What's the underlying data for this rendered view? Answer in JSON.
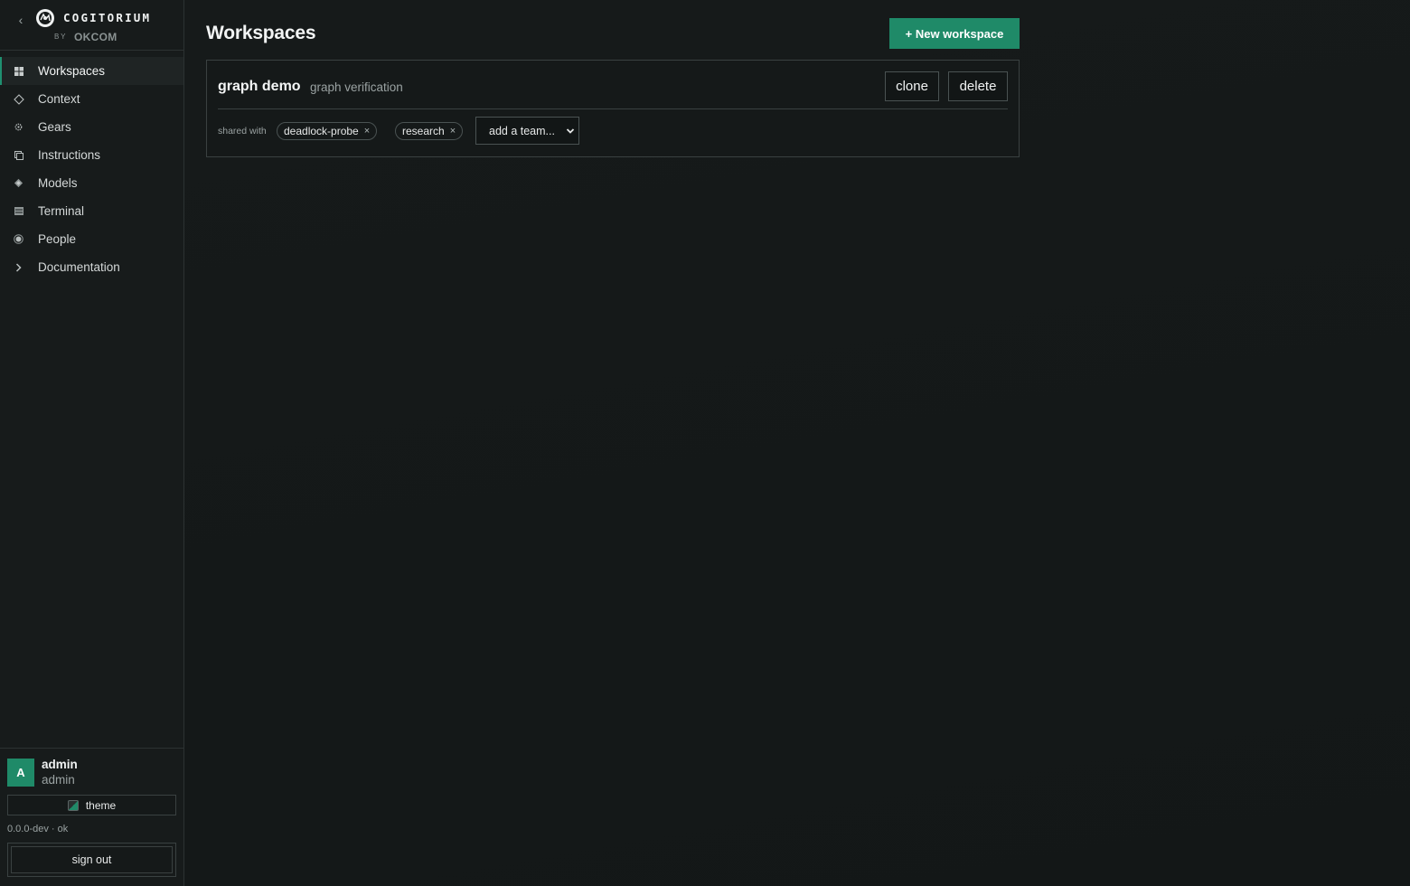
{
  "brand": {
    "name": "COGITORIUM",
    "by": "BY",
    "maker": "OKCOM"
  },
  "sidebar": {
    "items": [
      {
        "label": "Workspaces",
        "icon": "grid-icon",
        "active": true
      },
      {
        "label": "Context",
        "icon": "diamond-outline-icon",
        "active": false
      },
      {
        "label": "Gears",
        "icon": "gear-icon",
        "active": false
      },
      {
        "label": "Instructions",
        "icon": "document-icon",
        "active": false
      },
      {
        "label": "Models",
        "icon": "diamond-filled-icon",
        "active": false
      },
      {
        "label": "Terminal",
        "icon": "terminal-icon",
        "active": false
      },
      {
        "label": "People",
        "icon": "person-icon",
        "active": false
      },
      {
        "label": "Documentation",
        "icon": "chevron-right-icon",
        "active": false
      }
    ],
    "footer": {
      "avatar_letter": "A",
      "user_name": "admin",
      "user_role": "admin",
      "theme_label": "theme",
      "version": "0.0.0-dev · ok",
      "signout_label": "sign out"
    }
  },
  "main": {
    "title": "Workspaces",
    "new_button": "+ New workspace",
    "workspaces": [
      {
        "name": "graph demo",
        "description": "graph verification",
        "clone_label": "clone",
        "delete_label": "delete",
        "shared_label": "shared with",
        "teams": [
          "deadlock-probe",
          "research"
        ],
        "add_team_placeholder": "add a team..."
      }
    ]
  },
  "colors": {
    "accent": "#1f8a68",
    "background": "#141818",
    "sidebar": "#171b1b",
    "border": "#3a4141"
  }
}
